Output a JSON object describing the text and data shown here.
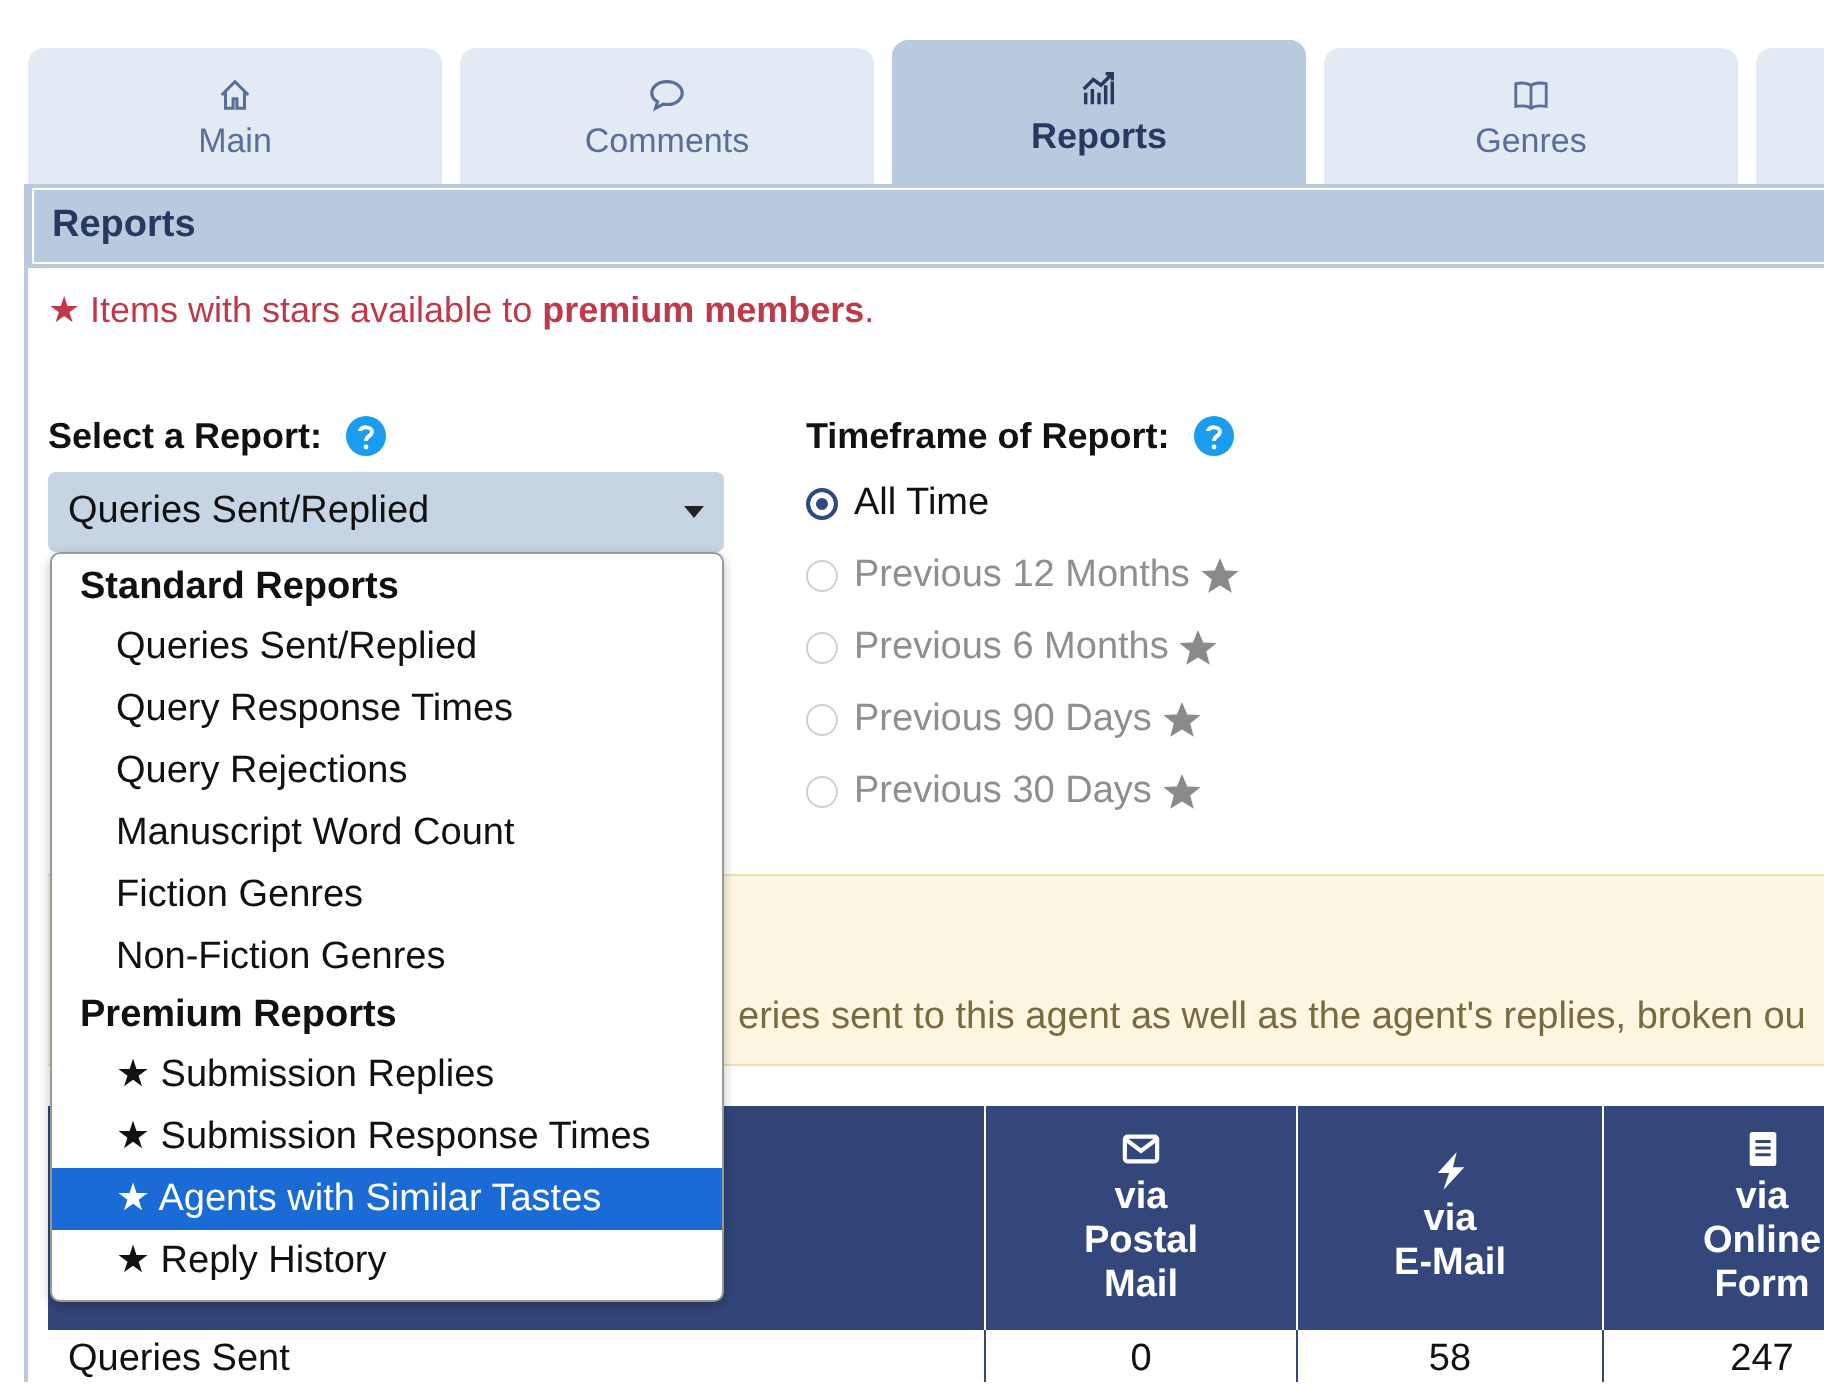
{
  "tabs": [
    {
      "label": "Main",
      "selected": false
    },
    {
      "label": "Comments",
      "selected": false
    },
    {
      "label": "Reports",
      "selected": true
    },
    {
      "label": "Genres",
      "selected": false
    },
    {
      "selected": false
    }
  ],
  "panel": {
    "title": "Reports"
  },
  "premium_note": "★ Items with stars available to **premium members**.",
  "report_select": {
    "label": "Select a Report:",
    "value": "Queries Sent/Replied",
    "expanded": true,
    "groups": [
      {
        "label": "Standard Reports",
        "options": [
          {
            "label": "Queries Sent/Replied",
            "selected": false
          },
          {
            "label": "Query Response Times",
            "selected": false
          },
          {
            "label": "Query Rejections",
            "selected": false
          },
          {
            "label": "Manuscript Word Count",
            "selected": false
          },
          {
            "label": "Fiction Genres",
            "selected": false
          },
          {
            "label": "Non-Fiction Genres",
            "selected": false
          }
        ]
      },
      {
        "label": "Premium Reports",
        "options": [
          {
            "label": "★ Submission Replies",
            "selected": false
          },
          {
            "label": "★ Submission Response Times",
            "selected": false
          },
          {
            "label": "★ Agents with Similar Tastes",
            "selected": true
          },
          {
            "label": "★ Reply History",
            "selected": false
          }
        ]
      }
    ]
  },
  "timeframe": {
    "label": "Timeframe of Report:",
    "options": [
      {
        "label": "All Time",
        "selected": true,
        "disabled": false,
        "premium": false
      },
      {
        "label": "Previous 12 Months",
        "selected": false,
        "disabled": true,
        "premium": true
      },
      {
        "label": "Previous 6 Months",
        "selected": false,
        "disabled": true,
        "premium": true
      },
      {
        "label": "Previous 90 Days",
        "selected": false,
        "disabled": true,
        "premium": true
      },
      {
        "label": "Previous 30 Days",
        "selected": false,
        "disabled": true,
        "premium": true
      }
    ]
  },
  "info_box": {
    "text": "eries sent to this agent as well as the agent's replies, broken ou"
  },
  "table": {
    "columns": [
      {},
      {
        "label": "via\nPostal\nMail"
      },
      {
        "label": "via\nE-Mail"
      },
      {
        "label": "via\nOnline\nForm"
      }
    ],
    "rows": [
      {
        "cells": [
          "Queries Sent",
          "0",
          "58",
          "247"
        ]
      }
    ]
  }
}
